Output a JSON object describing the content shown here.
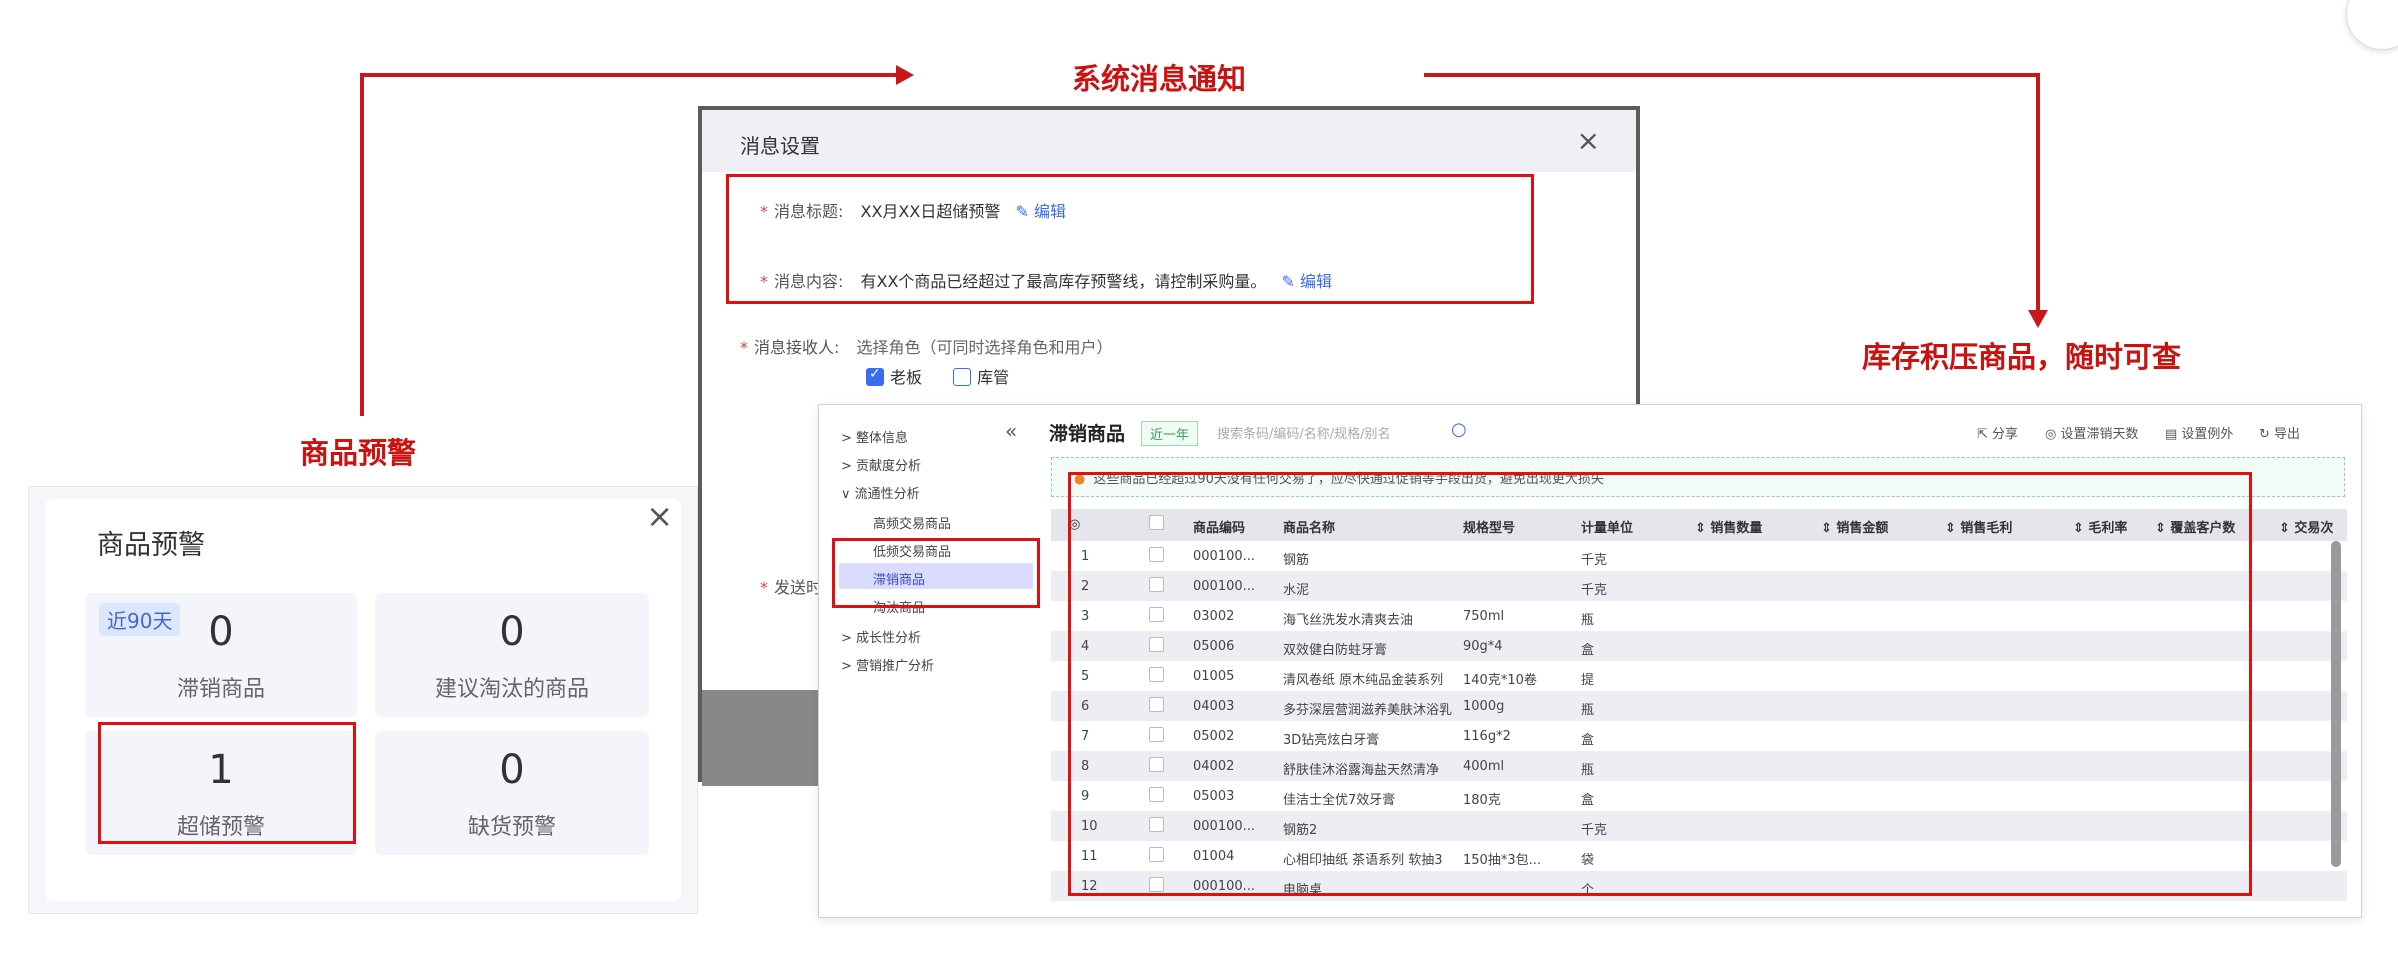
{
  "annotations": {
    "system_message": "系统消息通知",
    "product_warning": "商品预警",
    "overstock": "库存积压商品，随时可查"
  },
  "message_dialog": {
    "title": "消息设置",
    "close": "×",
    "required_mark": "*",
    "title_label": "消息标题:",
    "title_value": "XX月XX日超储预警",
    "edit_label": "编辑",
    "content_label": "消息内容:",
    "content_value": "有XX个商品已经超过了最高库存预警线，请控制采购量。",
    "receiver_label": "消息接收人:",
    "receiver_hint": "选择角色（可同时选择角色和用户）",
    "roles": [
      {
        "label": "老板",
        "checked": true
      },
      {
        "label": "库管",
        "checked": false
      }
    ],
    "send_label": "发送时"
  },
  "warning_card": {
    "title": "商品预警",
    "close": "×",
    "badge": "近90天",
    "tiles": [
      {
        "value": "0",
        "label": "滞销商品"
      },
      {
        "value": "0",
        "label": "建议淘汰的商品"
      },
      {
        "value": "1",
        "label": "超储预警"
      },
      {
        "value": "0",
        "label": "缺货预警"
      }
    ]
  },
  "slow_panel": {
    "collapse": "«",
    "sidebar": {
      "groups": [
        "> 整体信息",
        "> 贡献度分析",
        "∨ 流通性分析"
      ],
      "subs": [
        "高频交易商品",
        "低频交易商品",
        "滞销商品",
        "淘汰商品"
      ],
      "rest": [
        "> 成长性分析",
        "> 营销推广分析"
      ]
    },
    "title": "滞销商品",
    "period_tag": "近一年",
    "search_placeholder": "搜索条码/编码/名称/规格/别名",
    "tools": [
      "分享",
      "设置滞销天数",
      "设置例外",
      "导出"
    ],
    "notice": "这些商品已经超过90天没有任何交易了，应尽快通过促销等手段出货，避免出现更大损失",
    "columns": [
      "商品编码",
      "商品名称",
      "规格型号",
      "计量单位",
      "销售数量",
      "销售金额",
      "销售毛利",
      "毛利率",
      "覆盖客户数",
      "交易次"
    ],
    "rows": [
      [
        "1",
        "000100...",
        "钢筋",
        "",
        "千克"
      ],
      [
        "2",
        "000100...",
        "水泥",
        "",
        "千克"
      ],
      [
        "3",
        "03002",
        "海飞丝洗发水清爽去油",
        "750ml",
        "瓶"
      ],
      [
        "4",
        "05006",
        "双效健白防蛀牙膏",
        "90g*4",
        "盒"
      ],
      [
        "5",
        "01005",
        "清风卷纸 原木纯品金装系列",
        "140克*10卷",
        "提"
      ],
      [
        "6",
        "04003",
        "多芬深层营润滋养美肤沐浴乳",
        "1000g",
        "瓶"
      ],
      [
        "7",
        "05002",
        "3D钻亮炫白牙膏",
        "116g*2",
        "盒"
      ],
      [
        "8",
        "04002",
        "舒肤佳沐浴露海盐天然清净",
        "400ml",
        "瓶"
      ],
      [
        "9",
        "05003",
        "佳洁士全优7效牙膏",
        "180克",
        "盒"
      ],
      [
        "10",
        "000100...",
        "钢筋2",
        "",
        "千克"
      ],
      [
        "11",
        "01004",
        "心相印抽纸 茶语系列 软抽3",
        "150抽*3包...",
        "袋"
      ],
      [
        "12",
        "000100...",
        "电脑桌",
        "",
        "个"
      ]
    ]
  }
}
